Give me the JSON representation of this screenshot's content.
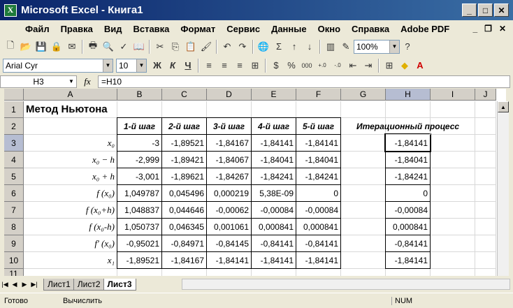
{
  "window": {
    "title": "Microsoft Excel - Книга1"
  },
  "menu": [
    "Файл",
    "Правка",
    "Вид",
    "Вставка",
    "Формат",
    "Сервис",
    "Данные",
    "Окно",
    "Справка",
    "Adobe PDF"
  ],
  "toolbar": {
    "zoom": "100%",
    "font": "Arial Cyr",
    "size": "10",
    "bold": "Ж",
    "italic": "К",
    "underline": "Ч",
    "percent": "%",
    "thousands": "000"
  },
  "formula_bar": {
    "cell_ref": "H3",
    "fx": "fx",
    "formula": "=H10"
  },
  "columns": [
    "A",
    "B",
    "C",
    "D",
    "E",
    "F",
    "G",
    "H",
    "I",
    "J"
  ],
  "rows": [
    "1",
    "2",
    "3",
    "4",
    "5",
    "6",
    "7",
    "8",
    "9",
    "10",
    "11"
  ],
  "sheet": {
    "title": "Метод Ньютона",
    "steps": [
      "1-й шаг",
      "2-й шаг",
      "3-й шаг",
      "4-й шаг",
      "5-й шаг"
    ],
    "iter_header": "Итерационный процесс",
    "data": [
      {
        "label": "x₀",
        "vals": [
          "-3",
          "-1,89521",
          "-1,84167",
          "-1,84141",
          "-1,84141"
        ],
        "h": "-1,84141"
      },
      {
        "label": "x₀ − h",
        "vals": [
          "-2,999",
          "-1,89421",
          "-1,84067",
          "-1,84041",
          "-1,84041"
        ],
        "h": "-1,84041"
      },
      {
        "label": "x₀ + h",
        "vals": [
          "-3,001",
          "-1,89621",
          "-1,84267",
          "-1,84241",
          "-1,84241"
        ],
        "h": "-1,84241"
      },
      {
        "label": "f (x₀)",
        "vals": [
          "1,049787",
          "0,045496",
          "0,000219",
          "5,38E-09",
          "0"
        ],
        "h": "0"
      },
      {
        "label": "f (x₀+h)",
        "vals": [
          "1,048837",
          "0,044646",
          "-0,00062",
          "-0,00084",
          "-0,00084"
        ],
        "h": "-0,00084"
      },
      {
        "label": "f (x₀-h)",
        "vals": [
          "1,050737",
          "0,046345",
          "0,001061",
          "0,000841",
          "0,000841"
        ],
        "h": "0,000841"
      },
      {
        "label": "f′ (x₀)",
        "vals": [
          "-0,95021",
          "-0,84971",
          "-0,84145",
          "-0,84141",
          "-0,84141"
        ],
        "h": "-0,84141"
      },
      {
        "label": "x₁",
        "vals": [
          "-1,89521",
          "-1,84167",
          "-1,84141",
          "-1,84141",
          "-1,84141"
        ],
        "h": "-1,84141"
      }
    ]
  },
  "tabs": [
    "Лист1",
    "Лист2",
    "Лист3"
  ],
  "status": {
    "ready": "Готово",
    "calc": "Вычислить",
    "num": "NUM"
  }
}
